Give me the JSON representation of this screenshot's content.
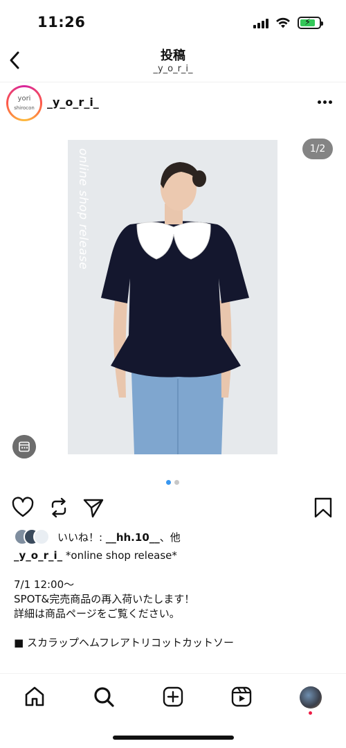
{
  "status_bar": {
    "time": "11:26",
    "battery_color": "#34c759"
  },
  "header": {
    "title": "投稿",
    "subtitle": "_y_o_r_i_",
    "back_icon": "chevron-left-icon"
  },
  "post": {
    "author": {
      "username": "_y_o_r_i_",
      "avatar_text_top": "yori",
      "avatar_text_bottom": "shirocon"
    },
    "media": {
      "overlay_text": "online shop release",
      "page_counter": "1/2",
      "current_page": 1,
      "total_pages": 2,
      "dot_active_color": "#3897f0",
      "dot_inactive_color": "#c7c7c7"
    },
    "actions": {
      "like_icon": "heart-icon",
      "repost_icon": "repost-icon",
      "share_icon": "send-icon",
      "save_icon": "bookmark-icon"
    },
    "likes": {
      "prefix": "いいね！: ",
      "user": "__hh.10__",
      "suffix": "、他"
    },
    "caption": {
      "username": "_y_o_r_i_",
      "first_line": " *online shop release*",
      "lines": [
        "7/1 12:00～",
        "SPOT&完売商品の再入荷いたします！",
        "詳細は商品ページをご覧ください。",
        "■ スカラップヘムフレアトリコットカットソー"
      ]
    }
  },
  "bottom_nav": {
    "items": [
      "home-icon",
      "search-icon",
      "create-icon",
      "reels-icon",
      "profile-avatar"
    ],
    "notification_dot_color": "#ed1c45"
  }
}
